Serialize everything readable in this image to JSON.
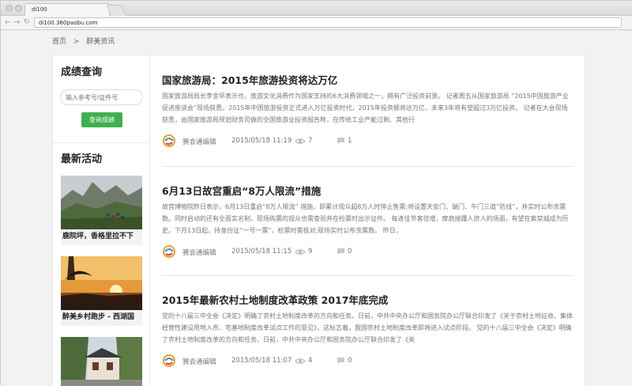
{
  "browser": {
    "tab_title": "di100",
    "url": "di100.360paobu.com",
    "back_icon": "arrow-left-icon",
    "forward_icon": "arrow-right-icon",
    "reload_icon": "reload-icon"
  },
  "breadcrumb": {
    "home": "首页",
    "separator": ">",
    "current": "醉美资讯"
  },
  "sidebar": {
    "score_title": "成绩查询",
    "search_placeholder": "输入参考号/证件号",
    "search_button": "查询成绩",
    "activity_title": "最新活动",
    "activities": [
      {
        "caption": "鹿院坪，香格里拉不下",
        "image_icon": "mountain-photo-icon"
      },
      {
        "caption": "醉美乡村跑步 - 西湖国",
        "image_icon": "sunset-photo-icon"
      },
      {
        "caption": "",
        "image_icon": "building-photo-icon"
      }
    ]
  },
  "articles": [
    {
      "title": "国家旅游局：2015年旅游投资将达万亿",
      "body": "国家旅游局局长李金早表示也，旅游文化消费作为国家支持的6大消费领域之一，拥有广泛投资前景。      记者周五从国家旅游局 “2015中国旅游产业促进座谈会”现场获悉，2015年中国旅游投资正式进入万亿投资时代，2015年投资额将达万亿，未来3年将有望超过3万亿投资。      记者在大会现场获悉，由国家旅游局规划财务司做的全国旅游业投资报告称，在传统工业产能过剩、其他行",
      "author": "赛会通编辑",
      "date": "2015/05/18 11:19",
      "views": "7",
      "comments": "1"
    },
    {
      "title": "6月13日故宫重启“8万人限流”措施",
      "body": "故宫博物院昨日表示，6月13日重启“8万人限流” 措施，即累计观众超8万人时停止售票;将设置天安门、端门、午门三道“防线”，并实时公布余票数。同时启动的还有全面实名制，现场购票的观众也需查验并在检票时出示证件。 每逢佳节客倍增，摩肩接踵人挤人的场面，有望在紫禁城成为历史。下月13日起，持身份证“一号一票”，检票时需核对;现场实时公布余票数。     昨日，",
      "author": "赛会通编辑",
      "date": "2015/05/18 11:15",
      "views": "9",
      "comments": "0"
    },
    {
      "title": "2015年最新农村土地制度改革政策 2017年底完成",
      "body": "党的十八届三中全会《决定》明确了农村土地制度改革的方向和任务。日前，中共中央办公厅和国务院办公厅联合印发了《关于农村土地征收、集体经营性建设用地入市、宅基地制度改革试点工作的意见》，这标志着，我国农村土地制度改革即将进入试点阶段。 党的十八届三中全会《决定》明确了农村土地制度改革的方向和任务。日前，中共中央办公厅和国务院办公厅联合印发了《关",
      "author": "赛会通编辑",
      "date": "2015/05/18 11:07",
      "views": "4",
      "comments": "0"
    }
  ],
  "icons": {
    "author_logo": "saihuitong-logo-icon",
    "views": "eye-icon",
    "comments": "comment-bubble-icon"
  },
  "colors": {
    "accent_green": "#3eb04f"
  }
}
